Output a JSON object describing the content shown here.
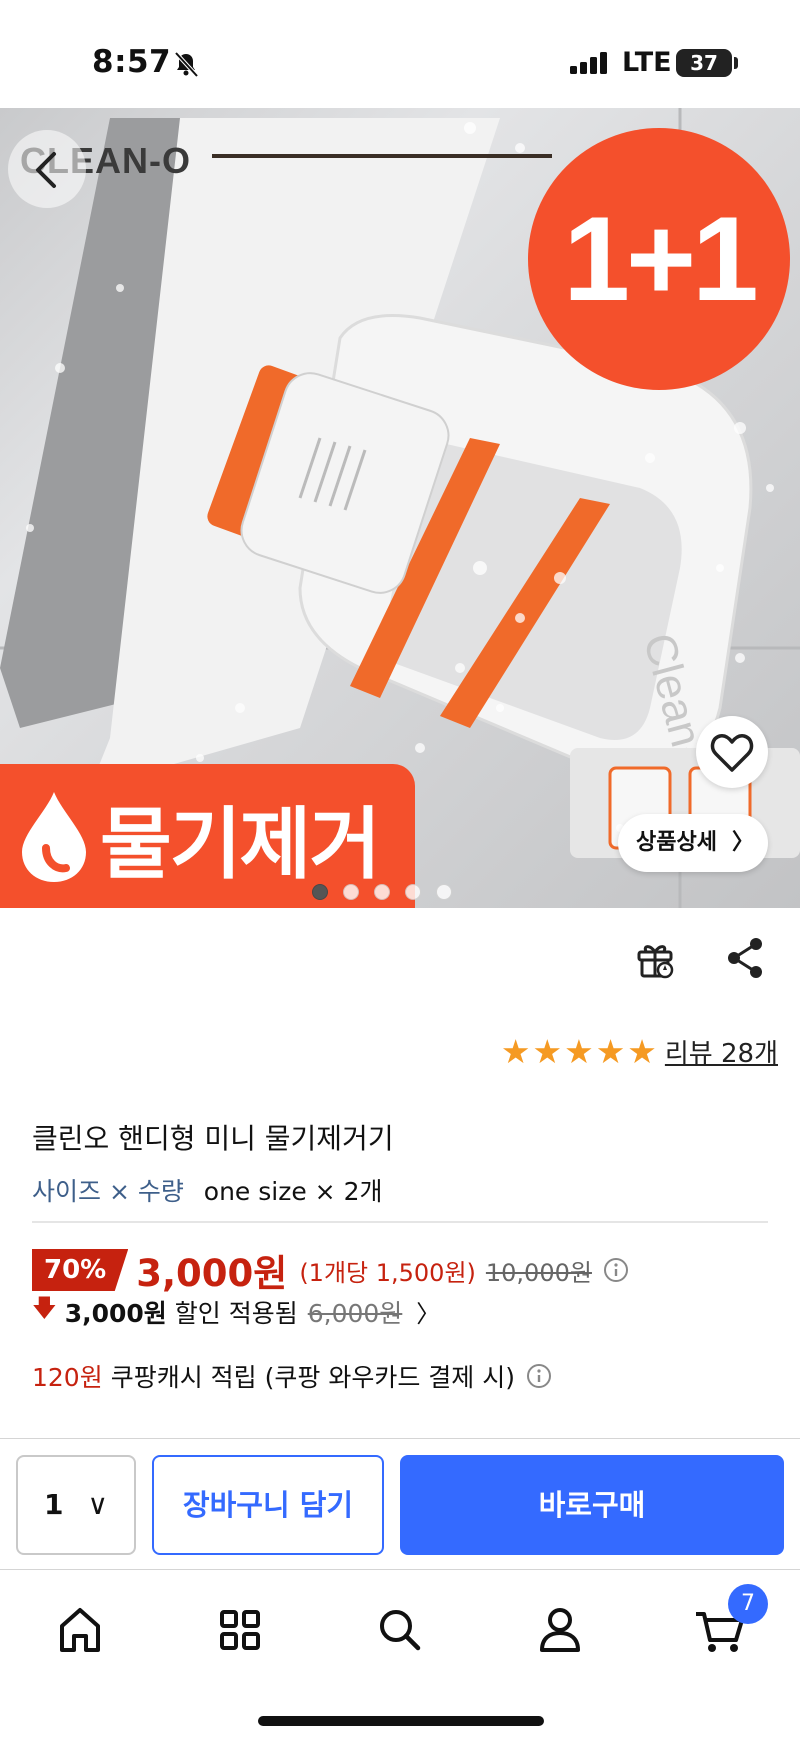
{
  "status_bar": {
    "time": "8:57",
    "network": "LTE",
    "battery": "37"
  },
  "hero": {
    "brand": "CLEAN-O",
    "promo_badge": "1+1",
    "promo_label": "물기제거",
    "detail_button": "상품상세",
    "slide_count": 5,
    "active_slide": 1,
    "accent_color": "#f4502c"
  },
  "rating": {
    "stars": 5,
    "review_link": "리뷰 28개"
  },
  "product": {
    "title": "클린오 핸디형 미니 물기제거기",
    "option_label": "사이즈 × 수량",
    "option_value": "one size × 2개"
  },
  "price": {
    "discount_rate": "70%",
    "sale_price": "3,000원",
    "unit_price": "(1개당 1,500원)",
    "original_price": "10,000원",
    "coupon_discount": "3,000원",
    "coupon_applied_text": "할인 적용됨",
    "pre_coupon_price": "6,000원"
  },
  "cashback": {
    "amount": "120원",
    "text": "쿠팡캐시 적립 (쿠팡 와우카드 결제 시)"
  },
  "purchase_bar": {
    "quantity": "1",
    "cart_button": "장바구니 담기",
    "buy_button": "바로구매",
    "brand_color": "#346aff"
  },
  "tab_bar": {
    "items": [
      "home-icon",
      "category-icon",
      "search-icon",
      "my-page-icon",
      "cart-icon"
    ],
    "cart_count": "7"
  }
}
